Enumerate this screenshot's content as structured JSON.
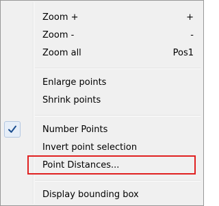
{
  "menu": {
    "items": [
      {
        "label": "Zoom +",
        "shortcut": "+"
      },
      {
        "label": "Zoom -",
        "shortcut": "-"
      },
      {
        "label": "Zoom all",
        "shortcut": "Pos1"
      },
      {
        "label": "Enlarge points",
        "shortcut": ""
      },
      {
        "label": "Shrink points",
        "shortcut": ""
      },
      {
        "label": "Number Points",
        "shortcut": "",
        "checked": true
      },
      {
        "label": "Invert point selection",
        "shortcut": ""
      },
      {
        "label": "Point Distances...",
        "shortcut": "",
        "highlighted": true
      },
      {
        "label": "Display bounding box",
        "shortcut": ""
      }
    ],
    "check_icon": "checkmark-icon",
    "colors": {
      "background": "#f0f0f0",
      "border": "#979797",
      "highlight_outline": "#e02020",
      "check_color": "#1a4d8f"
    }
  }
}
